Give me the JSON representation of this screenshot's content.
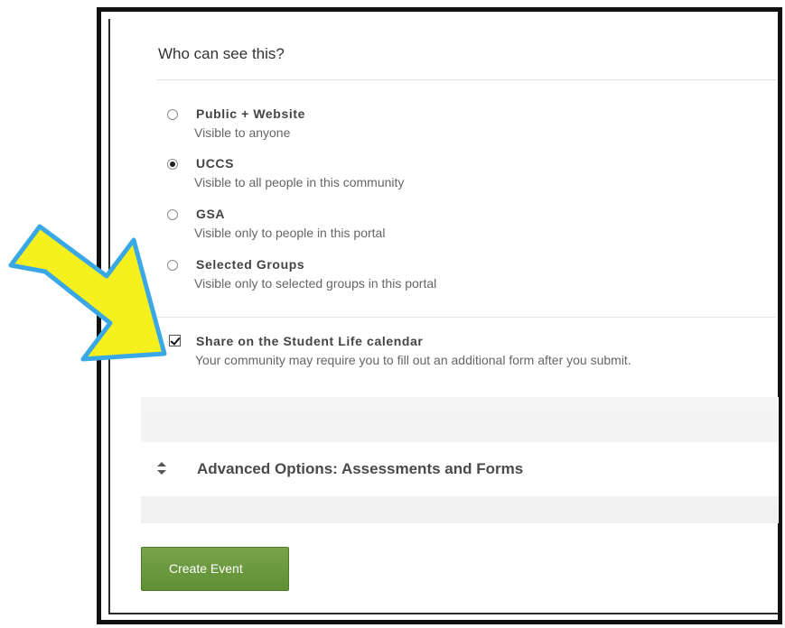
{
  "visibility": {
    "heading": "Who can see this?",
    "options": [
      {
        "title": "Public + Website",
        "description": "Visible to anyone",
        "selected": false
      },
      {
        "title": "UCCS",
        "description": "Visible to all people in this community",
        "selected": true
      },
      {
        "title": "GSA",
        "description": "Visible only to people in this portal",
        "selected": false
      },
      {
        "title": "Selected Groups",
        "description": "Visible only to selected groups in this portal",
        "selected": false
      }
    ]
  },
  "share": {
    "checked": true,
    "title": "Share on the Student Life calendar",
    "description": "Your community may require you to fill out an additional form after you submit."
  },
  "advanced": {
    "label": "Advanced Options: Assessments and Forms",
    "icon": "sort-toggle-icon"
  },
  "submit": {
    "label": "Create Event",
    "color": "#6a9a3c"
  },
  "annotation": {
    "icon": "callout-arrow",
    "fill_color": "#f5f01e",
    "stroke_color": "#3aa7e6"
  }
}
